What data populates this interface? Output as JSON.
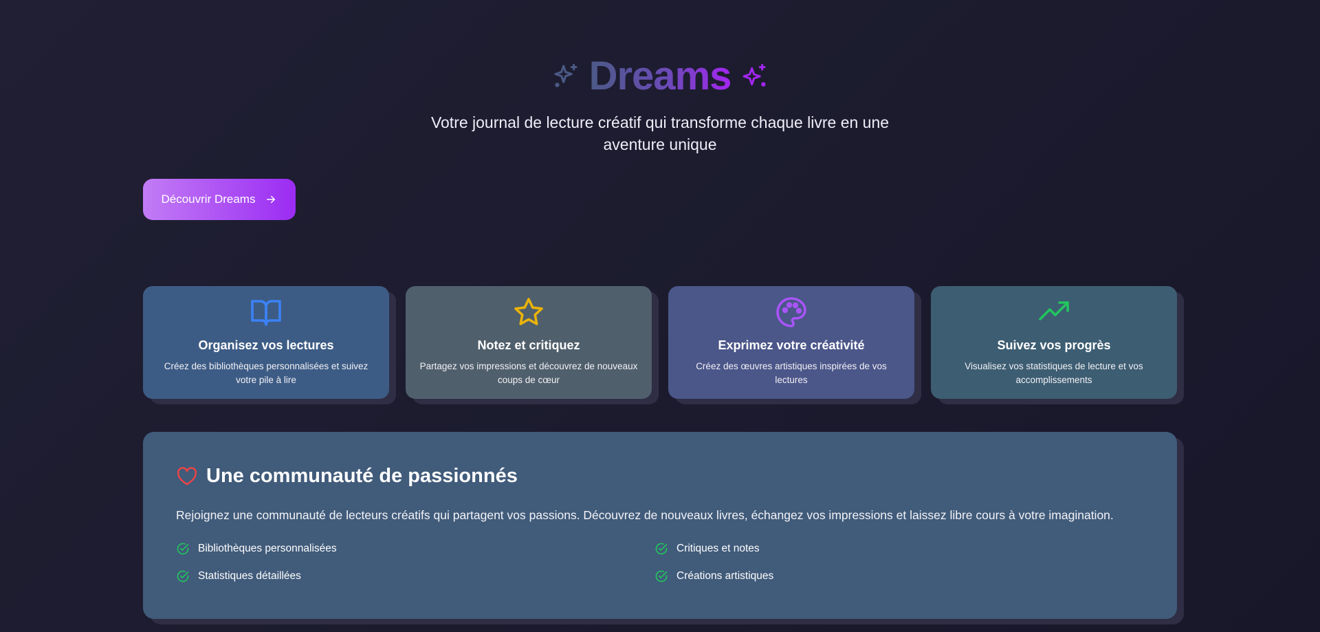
{
  "hero": {
    "title": "Dreams",
    "subtitle": "Votre journal de lecture créatif qui transforme chaque livre en une aventure unique",
    "cta_label": "Découvrir Dreams",
    "icons": [
      "sparkles-icon",
      "arrow-right-icon"
    ]
  },
  "features": [
    {
      "icon": "book-open-icon",
      "title": "Organisez vos lectures",
      "description": "Créez des bibliothèques personnalisées et suivez votre pile à lire",
      "color": "#3b82f6"
    },
    {
      "icon": "star-icon",
      "title": "Notez et critiquez",
      "description": "Partagez vos impressions et découvrez de nouveaux coups de cœur",
      "color": "#eab308"
    },
    {
      "icon": "palette-icon",
      "title": "Exprimez votre créativité",
      "description": "Créez des œuvres artistiques inspirées de vos lectures",
      "color": "#a855f7"
    },
    {
      "icon": "trending-up-icon",
      "title": "Suivez vos progrès",
      "description": "Visualisez vos statistiques de lecture et vos accomplissements",
      "color": "#22c55e"
    }
  ],
  "community": {
    "icon": "heart-icon",
    "title": "Une communauté de passionnés",
    "description": "Rejoignez une communauté de lecteurs créatifs qui partagent vos passions. Découvrez de nouveaux livres, échangez vos impressions et laissez libre cours à votre imagination.",
    "items": [
      "Bibliothèques personnalisées",
      "Critiques et notes",
      "Statistiques détaillées",
      "Créations artistiques"
    ]
  },
  "colors": {
    "accent_gradient_start": "#c27cf5",
    "accent_gradient_end": "#9b2cf3",
    "heart": "#ef4444",
    "check": "#22c55e"
  }
}
